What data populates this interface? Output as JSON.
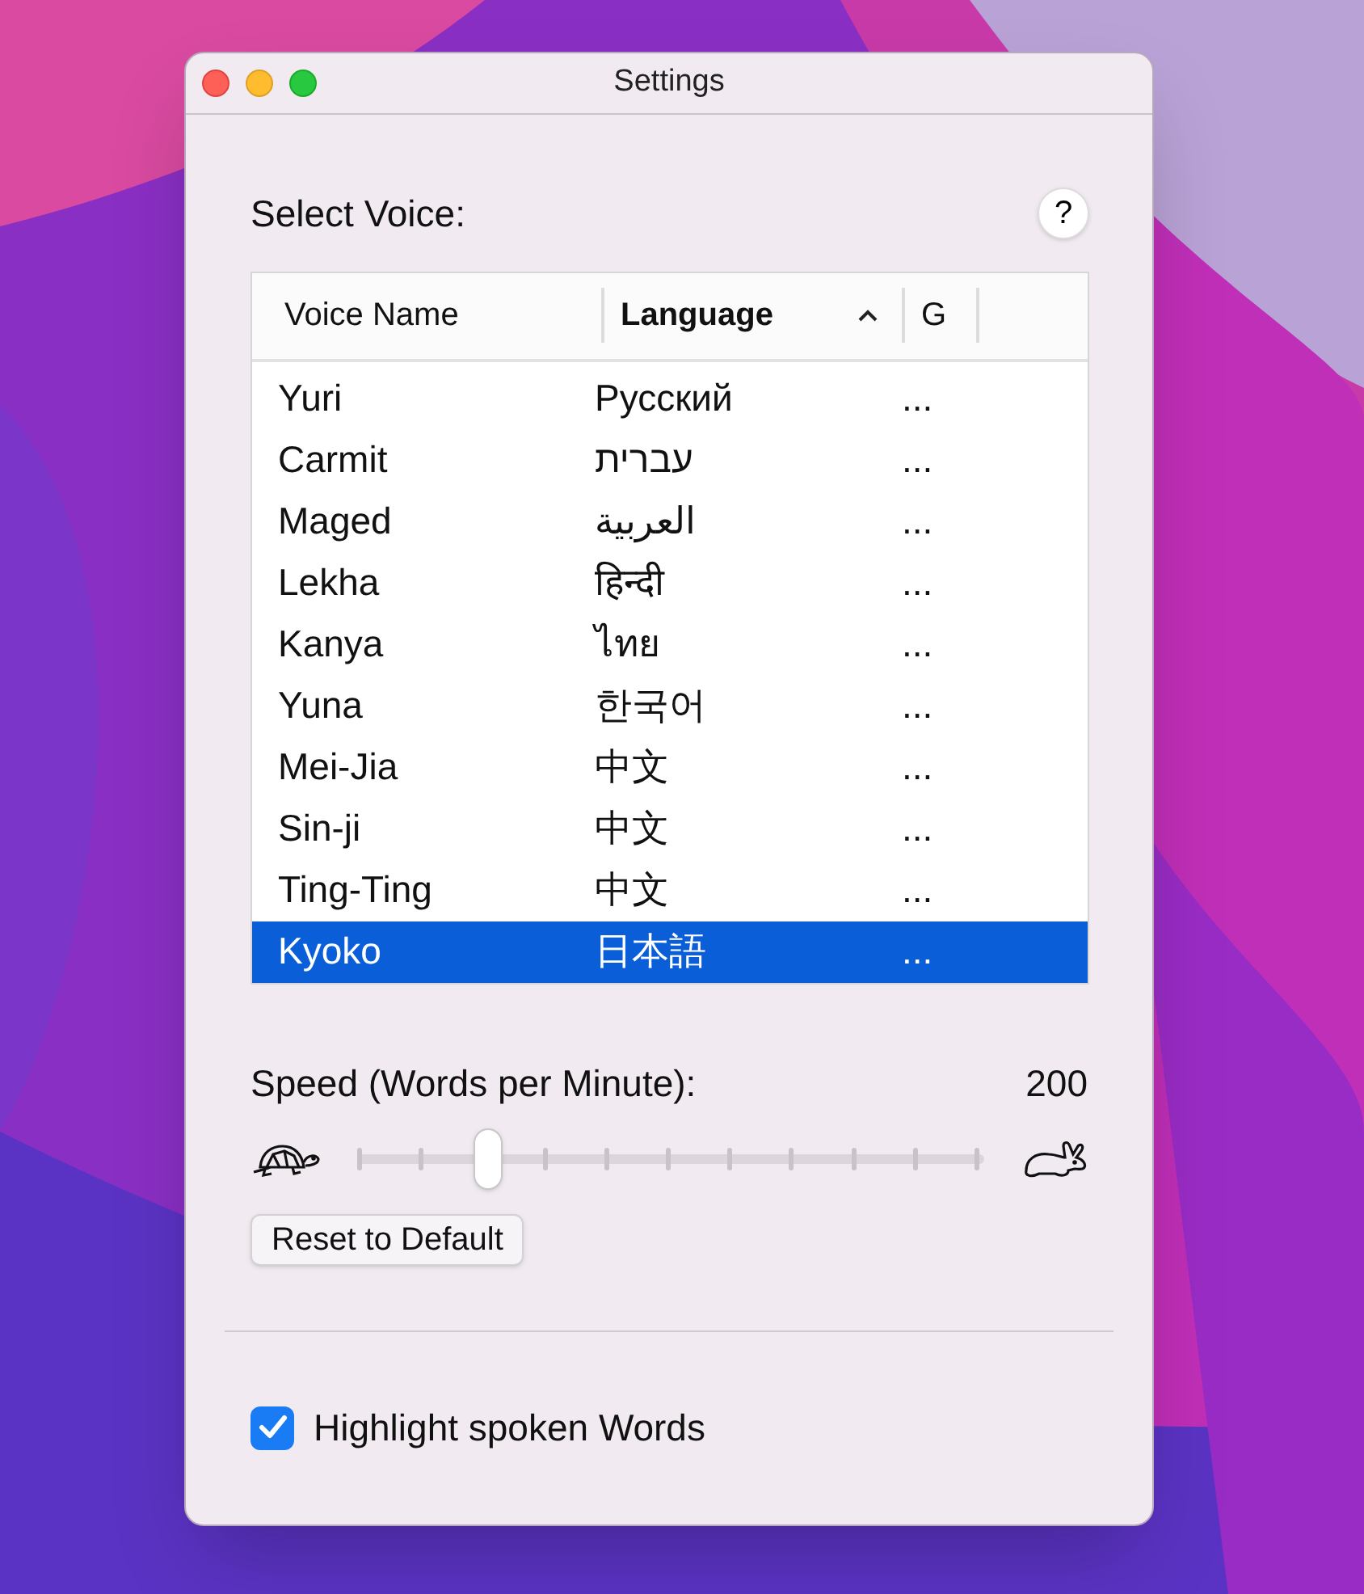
{
  "window": {
    "title": "Settings"
  },
  "voice_section": {
    "label": "Select Voice:",
    "help_button": "?"
  },
  "table": {
    "columns": [
      {
        "label": "Voice Name",
        "sorted": false
      },
      {
        "label": "Language",
        "sorted": true
      },
      {
        "label": "G",
        "sorted": false
      }
    ],
    "rows": [
      {
        "name": "Yuri",
        "language": "Русский",
        "column_3": "...",
        "selected": false
      },
      {
        "name": "Carmit",
        "language": "עברית",
        "column_3": "...",
        "selected": false
      },
      {
        "name": "Maged",
        "language": "العربية",
        "column_3": "...",
        "selected": false
      },
      {
        "name": "Lekha",
        "language": "हिन्दी",
        "column_3": "...",
        "selected": false
      },
      {
        "name": "Kanya",
        "language": "ไทย",
        "column_3": "...",
        "selected": false
      },
      {
        "name": "Yuna",
        "language": "한국어",
        "column_3": "...",
        "selected": false
      },
      {
        "name": "Mei-Jia",
        "language": "中文",
        "column_3": "...",
        "selected": false
      },
      {
        "name": "Sin-ji",
        "language": "中文",
        "column_3": "...",
        "selected": false
      },
      {
        "name": "Ting-Ting",
        "language": "中文",
        "column_3": "...",
        "selected": false
      },
      {
        "name": "Kyoko",
        "language": "日本語",
        "column_3": "...",
        "selected": true
      }
    ]
  },
  "speed": {
    "label": "Speed (Words per Minute):",
    "value": "200",
    "level": 0.21
  },
  "reset_button": "Reset to Default",
  "highlight_checkbox": {
    "label": "Highlight spoken Words",
    "checked": true
  }
}
